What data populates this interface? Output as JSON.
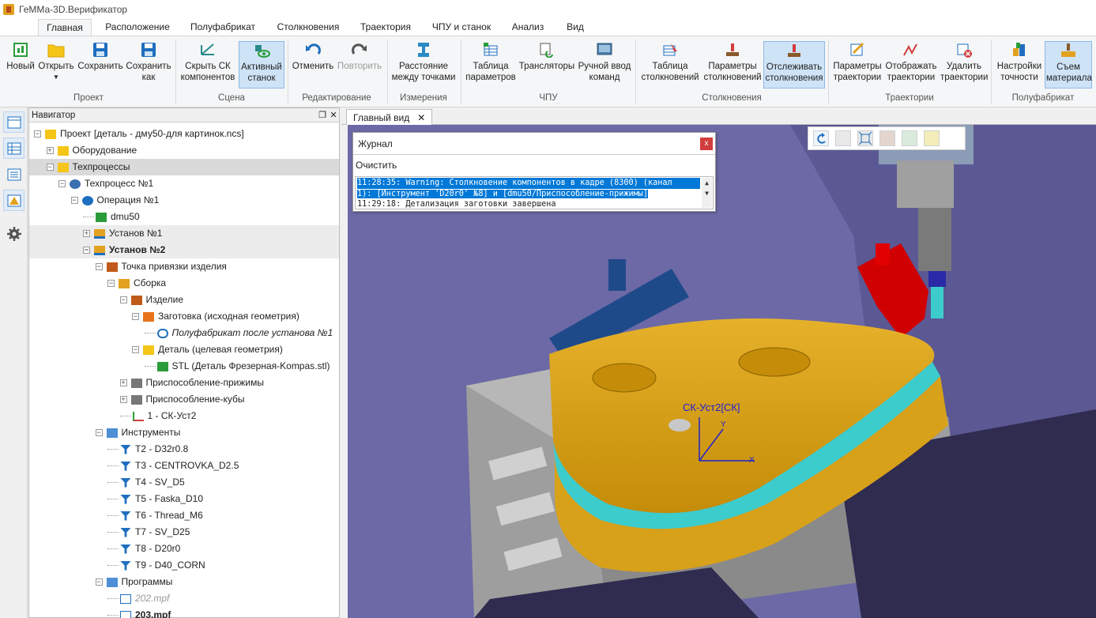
{
  "window": {
    "title": "ГеММа-3D.Верификатор"
  },
  "ribbon_tabs": [
    "Главная",
    "Расположение",
    "Полуфабрикат",
    "Столкновения",
    "Траектория",
    "ЧПУ и станок",
    "Анализ",
    "Вид"
  ],
  "ribbon": {
    "buttons": {
      "new": "Новый",
      "open": "Открыть",
      "save": "Сохранить",
      "save_as": "Сохранить как",
      "hide_cs": "Скрыть СК компонентов",
      "active_machine": "Активный станок",
      "undo": "Отменить",
      "redo": "Повторить",
      "distance": "Расстояние между точками",
      "param_table": "Таблица параметров",
      "translators": "Трансляторы",
      "manual_input": "Ручной ввод команд",
      "collision_table": "Таблица столкновений",
      "collision_params": "Параметры столкновений",
      "track_collisions": "Отслеживать столкновения",
      "traj_params": "Параметры траектории",
      "show_traj": "Отображать траектории",
      "delete_traj": "Удалить траектории",
      "precision": "Настройки точности",
      "material_removal": "Съем материала"
    },
    "groups": {
      "project": "Проект",
      "scene": "Сцена",
      "editing": "Редактирование",
      "measure": "Измерения",
      "cnc": "ЧПУ",
      "collisions": "Столкновения",
      "trajectories": "Траектории",
      "stock": "Полуфабрикат"
    }
  },
  "navigator": {
    "title": "Навигатор",
    "tree": [
      "Проект [деталь - дму50-для картинок.ncs]",
      "Оборудование",
      "Техпроцессы",
      "Техпроцесс №1",
      "Операция №1",
      "dmu50",
      "Установ №1",
      "Установ №2",
      "Точка привязки изделия",
      "Сборка",
      "Изделие",
      "Заготовка (исходная геометрия)",
      "Полуфабрикат после установа №1",
      "Деталь (целевая геометрия)",
      "STL (Деталь Фрезерная-Kompas.stl)",
      "Приспособление-прижимы",
      "Приспособление-кубы",
      "1 - СК-Уст2",
      "Инструменты",
      "T2 - D32r0.8",
      "T3 - CENTROVKA_D2.5",
      "T4 - SV_D5",
      "T5 - Faska_D10",
      "T6 - Thread_M6",
      "T7 - SV_D25",
      "T8 - D20r0",
      "T9 - D40_CORN",
      "Программы",
      "202.mpf",
      "203.mpf"
    ]
  },
  "main_view": {
    "tab": "Главный вид"
  },
  "journal": {
    "title": "Журнал",
    "clear": "Очистить",
    "log_line_1": "11:28:35: Warning: Столкновение компонентов в кадре (8300) (канал",
    "log_line_2": "1): [Инструмент 'D20r0' №8] и [dmu50/Приспособление-прижимы]",
    "log_line_3": "11:29:18: Детализация заготовки завершена"
  },
  "scene": {
    "cs_label": "СК-Уст2[СК]",
    "axis_x": "X",
    "axis_y": "Y"
  }
}
